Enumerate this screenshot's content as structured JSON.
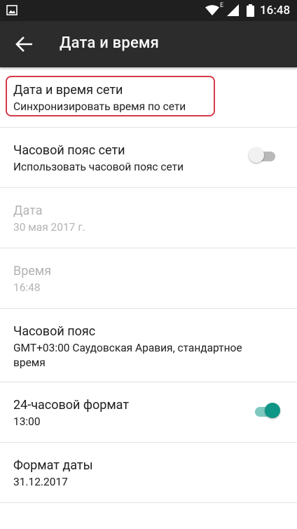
{
  "status_bar": {
    "signal_type": "E",
    "time": "16:48",
    "icons": [
      "image-icon",
      "wifi-icon",
      "signal-icon",
      "battery-icon"
    ]
  },
  "app_bar": {
    "title": "Дата и время",
    "back_icon": "arrow-left-icon"
  },
  "settings": [
    {
      "title": "Дата и время сети",
      "subtitle": "Синхронизировать время по сети",
      "enabled": true,
      "highlighted": true
    },
    {
      "title": "Часовой пояс сети",
      "subtitle": "Использовать часовой пояс сети",
      "enabled": true,
      "toggle": "off"
    },
    {
      "title": "Дата",
      "subtitle": "30 мая 2017 г.",
      "enabled": false
    },
    {
      "title": "Время",
      "subtitle": "16:48",
      "enabled": false
    },
    {
      "title": "Часовой пояс",
      "subtitle": "GMT+03:00 Саудовская Аравия, стандартное время",
      "enabled": true
    },
    {
      "title": "24-часовой формат",
      "subtitle": "13:00",
      "enabled": true,
      "toggle": "on"
    },
    {
      "title": "Формат даты",
      "subtitle": "31.12.2017",
      "enabled": true
    }
  ],
  "colors": {
    "status_bar_bg": "#1f1f1f",
    "app_bar_bg": "#2c2c2c",
    "highlight_border": "#d63a4a",
    "switch_on_accent": "#0e9687",
    "disabled_text": "#b3b3b3"
  }
}
